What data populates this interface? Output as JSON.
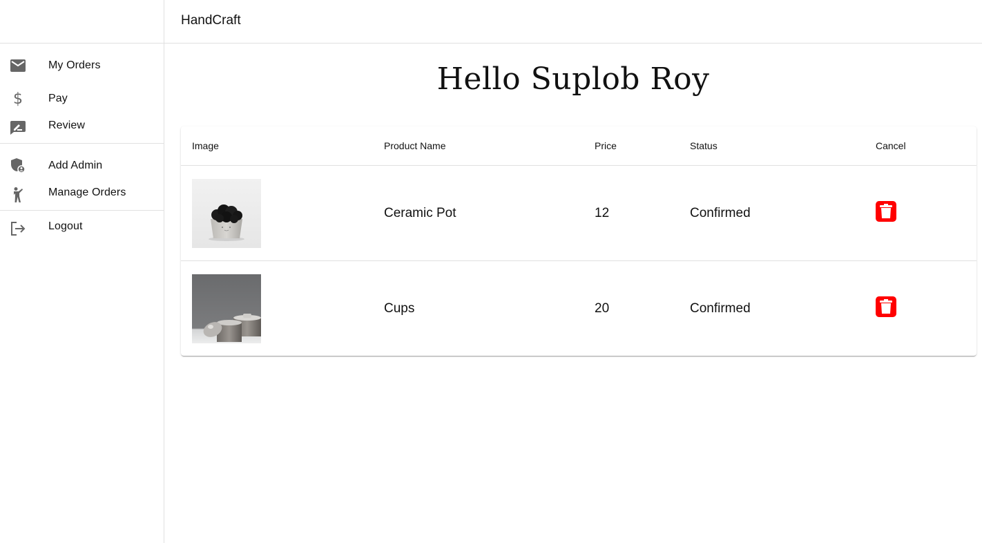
{
  "app": {
    "brand": "HandCraft"
  },
  "sidebar": {
    "groups": [
      {
        "items": [
          {
            "label": "My Orders",
            "icon": "mail-icon"
          },
          {
            "label": "Pay",
            "icon": "dollar-icon"
          },
          {
            "label": "Review",
            "icon": "rate-review-icon"
          }
        ]
      },
      {
        "items": [
          {
            "label": "Add Admin",
            "icon": "admin-shield-icon"
          },
          {
            "label": "Manage Orders",
            "icon": "person-walk-icon"
          }
        ]
      },
      {
        "items": [
          {
            "label": "Logout",
            "icon": "logout-icon"
          }
        ]
      }
    ]
  },
  "main": {
    "greeting": "Hello Suplob Roy",
    "table": {
      "columns": [
        "Image",
        "Product Name",
        "Price",
        "Status",
        "Cancel"
      ],
      "rows": [
        {
          "image": "ceramic-pot-photo",
          "name": "Ceramic Pot",
          "price": "12",
          "status": "Confirmed"
        },
        {
          "image": "cups-photo",
          "name": "Cups",
          "price": "20",
          "status": "Confirmed"
        }
      ]
    }
  },
  "colors": {
    "delete_button": "#ff0000",
    "icon_gray": "#666666",
    "divider": "#e0e0e0"
  }
}
